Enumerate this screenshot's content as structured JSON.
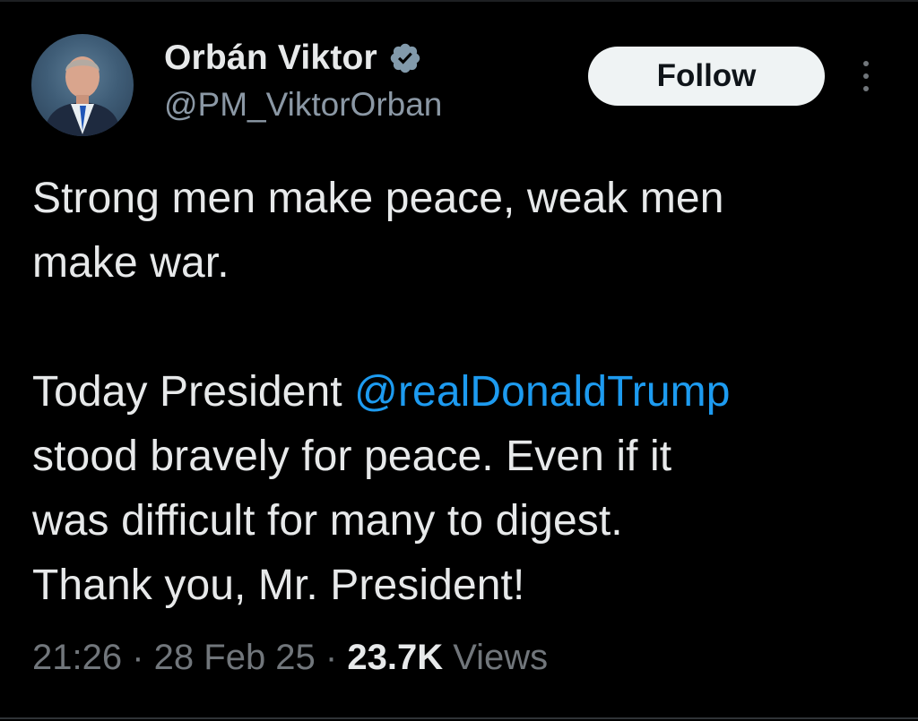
{
  "author": {
    "display_name": "Orbán Viktor",
    "handle": "@PM_ViktorOrban",
    "verified_icon": "verified-badge-icon",
    "avatar": "profile-photo"
  },
  "actions": {
    "follow_label": "Follow",
    "more_icon": "more-options-icon"
  },
  "tweet": {
    "line1": "Strong men make peace, weak men",
    "line2": "make war.",
    "para2_prefix": "Today President ",
    "mention": "@realDonaldTrump",
    "para2_line2": "stood bravely for peace. Even if it",
    "para2_line3": "was difficult for many to digest.",
    "para2_line4": "Thank you, Mr. President!"
  },
  "meta": {
    "time": "21:26",
    "separator": " · ",
    "date": "28 Feb 25",
    "views_count": "23.7K",
    "views_label": " Views"
  },
  "colors": {
    "background": "#000000",
    "text": "#e7e9ea",
    "secondary": "#71767b",
    "link": "#1d9bf0",
    "verified": "#829aab"
  }
}
